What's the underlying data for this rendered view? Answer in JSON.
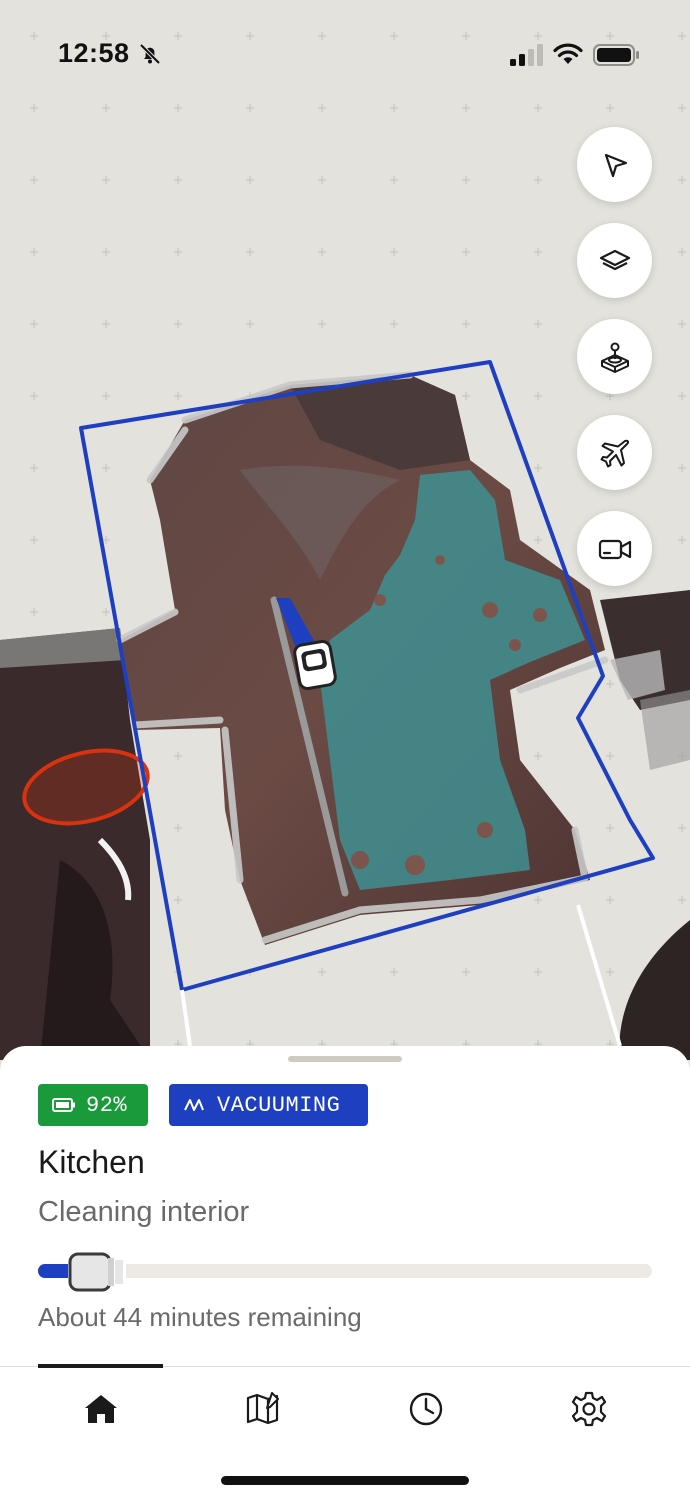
{
  "status_bar": {
    "time": "12:58",
    "icons": [
      "bell-slash-icon",
      "cellular-signal-icon",
      "wifi-icon",
      "battery-icon"
    ]
  },
  "map": {
    "tool_buttons": [
      {
        "name": "navigate-button",
        "icon": "navigation-arrow-icon"
      },
      {
        "name": "layers-button",
        "icon": "layers-icon"
      },
      {
        "name": "joystick-button",
        "icon": "joystick-icon"
      },
      {
        "name": "flight-button",
        "icon": "airplane-icon"
      },
      {
        "name": "camera-button",
        "icon": "video-camera-icon"
      }
    ],
    "colors": {
      "zone_outline": "#1d3fc0",
      "cleaned_area": "#3f8f92",
      "no_go_zone": "#d9320e"
    }
  },
  "sheet": {
    "battery_label": "92%",
    "status_label": "VACUUMING",
    "room": "Kitchen",
    "task": "Cleaning interior",
    "progress": 0.08,
    "time_remaining": "About 44 minutes remaining",
    "colors": {
      "battery_badge": "#1a9a3a",
      "status_badge": "#1d3fc0",
      "progress": "#1d3fc0"
    }
  },
  "tabs": [
    {
      "name": "tab-home",
      "icon": "home-icon",
      "selected": true
    },
    {
      "name": "tab-map",
      "icon": "map-edit-icon",
      "selected": false
    },
    {
      "name": "tab-history",
      "icon": "clock-icon",
      "selected": false
    },
    {
      "name": "tab-settings",
      "icon": "gear-icon",
      "selected": false
    }
  ]
}
